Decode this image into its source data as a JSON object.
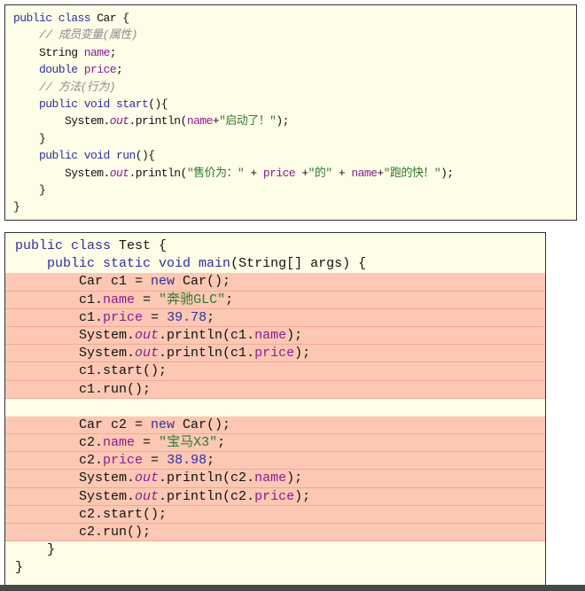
{
  "colors": {
    "keyword": "#2f2fa0",
    "field": "#8c1c8c",
    "string": "#2f7a2f",
    "comment": "#8a8a8a",
    "highlight": "#fcc8b4",
    "background": "#fefde8"
  },
  "car_class": {
    "lines": [
      {
        "hl": false,
        "tokens": [
          [
            "public class ",
            "kw"
          ],
          [
            "Car {",
            ""
          ]
        ]
      },
      {
        "hl": false,
        "tokens": [
          [
            "    ",
            ""
          ],
          [
            "// 成员变量(属性)",
            "cm"
          ]
        ]
      },
      {
        "hl": false,
        "tokens": [
          [
            "    String ",
            ""
          ],
          [
            "name",
            "fld"
          ],
          [
            ";",
            ""
          ]
        ]
      },
      {
        "hl": false,
        "tokens": [
          [
            "    ",
            ""
          ],
          [
            "double ",
            "kw"
          ],
          [
            "price",
            "fld"
          ],
          [
            ";",
            ""
          ]
        ]
      },
      {
        "hl": false,
        "tokens": [
          [
            "    ",
            ""
          ],
          [
            "// 方法(行为)",
            "cm"
          ]
        ]
      },
      {
        "hl": false,
        "tokens": [
          [
            "    ",
            ""
          ],
          [
            "public void start",
            "kw"
          ],
          [
            "(){",
            ""
          ]
        ]
      },
      {
        "hl": false,
        "tokens": [
          [
            "        System.",
            ""
          ],
          [
            "out",
            "it"
          ],
          [
            ".println(",
            ""
          ],
          [
            "name",
            "fld"
          ],
          [
            "+",
            ""
          ],
          [
            "\"启动了！\"",
            "str"
          ],
          [
            ");",
            ""
          ]
        ]
      },
      {
        "hl": false,
        "tokens": [
          [
            "    }",
            ""
          ]
        ]
      },
      {
        "hl": false,
        "tokens": [
          [
            "    ",
            ""
          ],
          [
            "public void run",
            "kw"
          ],
          [
            "(){",
            ""
          ]
        ]
      },
      {
        "hl": false,
        "tokens": [
          [
            "        System.",
            ""
          ],
          [
            "out",
            "it"
          ],
          [
            ".println(",
            ""
          ],
          [
            "\"售价为：\"",
            "str"
          ],
          [
            " + ",
            ""
          ],
          [
            "price",
            "fld"
          ],
          [
            " +",
            ""
          ],
          [
            "\"的\"",
            "str"
          ],
          [
            " + ",
            ""
          ],
          [
            "name",
            "fld"
          ],
          [
            "+",
            ""
          ],
          [
            "\"跑的快！\"",
            "str"
          ],
          [
            ");",
            ""
          ]
        ]
      },
      {
        "hl": false,
        "tokens": [
          [
            "    }",
            ""
          ]
        ]
      },
      {
        "hl": false,
        "tokens": [
          [
            "}",
            ""
          ]
        ]
      }
    ]
  },
  "test_class": {
    "lines": [
      {
        "hl": false,
        "tokens": [
          [
            "public class ",
            "kw"
          ],
          [
            "Test {",
            ""
          ]
        ]
      },
      {
        "hl": false,
        "tokens": [
          [
            "    ",
            ""
          ],
          [
            "public static void ",
            "kw"
          ],
          [
            "main",
            "kw"
          ],
          [
            "(String[] args) {",
            ""
          ]
        ]
      },
      {
        "hl": true,
        "tokens": [
          [
            "        Car c1 = ",
            ""
          ],
          [
            "new ",
            "kw"
          ],
          [
            "Car();",
            ""
          ]
        ]
      },
      {
        "hl": true,
        "tokens": [
          [
            "        c1.",
            ""
          ],
          [
            "name",
            "fld"
          ],
          [
            " = ",
            ""
          ],
          [
            "\"奔驰GLC\"",
            "str"
          ],
          [
            ";",
            ""
          ]
        ]
      },
      {
        "hl": true,
        "tokens": [
          [
            "        c1.",
            ""
          ],
          [
            "price",
            "fld"
          ],
          [
            " = ",
            ""
          ],
          [
            "39.78",
            "num"
          ],
          [
            ";",
            ""
          ]
        ]
      },
      {
        "hl": true,
        "tokens": [
          [
            "        System.",
            ""
          ],
          [
            "out",
            "it"
          ],
          [
            ".println(c1.",
            ""
          ],
          [
            "name",
            "fld"
          ],
          [
            ");",
            ""
          ]
        ]
      },
      {
        "hl": true,
        "tokens": [
          [
            "        System.",
            ""
          ],
          [
            "out",
            "it"
          ],
          [
            ".println(c1.",
            ""
          ],
          [
            "price",
            "fld"
          ],
          [
            ");",
            ""
          ]
        ]
      },
      {
        "hl": true,
        "tokens": [
          [
            "        c1.start();",
            ""
          ]
        ]
      },
      {
        "hl": true,
        "tokens": [
          [
            "        c1.run();",
            ""
          ]
        ]
      },
      {
        "hl": false,
        "tokens": [
          [
            "",
            ""
          ]
        ]
      },
      {
        "hl": true,
        "tokens": [
          [
            "        Car c2 = ",
            ""
          ],
          [
            "new ",
            "kw"
          ],
          [
            "Car();",
            ""
          ]
        ]
      },
      {
        "hl": true,
        "tokens": [
          [
            "        c2.",
            ""
          ],
          [
            "name",
            "fld"
          ],
          [
            " = ",
            ""
          ],
          [
            "\"宝马X3\"",
            "str"
          ],
          [
            ";",
            ""
          ]
        ]
      },
      {
        "hl": true,
        "tokens": [
          [
            "        c2.",
            ""
          ],
          [
            "price",
            "fld"
          ],
          [
            " = ",
            ""
          ],
          [
            "38.98",
            "num"
          ],
          [
            ";",
            ""
          ]
        ]
      },
      {
        "hl": true,
        "tokens": [
          [
            "        System.",
            ""
          ],
          [
            "out",
            "it"
          ],
          [
            ".println(c2.",
            ""
          ],
          [
            "name",
            "fld"
          ],
          [
            ");",
            ""
          ]
        ]
      },
      {
        "hl": true,
        "tokens": [
          [
            "        System.",
            ""
          ],
          [
            "out",
            "it"
          ],
          [
            ".println(c2.",
            ""
          ],
          [
            "price",
            "fld"
          ],
          [
            ");",
            ""
          ]
        ]
      },
      {
        "hl": true,
        "tokens": [
          [
            "        c2.start();",
            ""
          ]
        ]
      },
      {
        "hl": true,
        "tokens": [
          [
            "        c2.run();",
            ""
          ]
        ]
      },
      {
        "hl": false,
        "tokens": [
          [
            "    }",
            ""
          ]
        ]
      },
      {
        "hl": false,
        "tokens": [
          [
            "}",
            ""
          ]
        ]
      }
    ]
  }
}
